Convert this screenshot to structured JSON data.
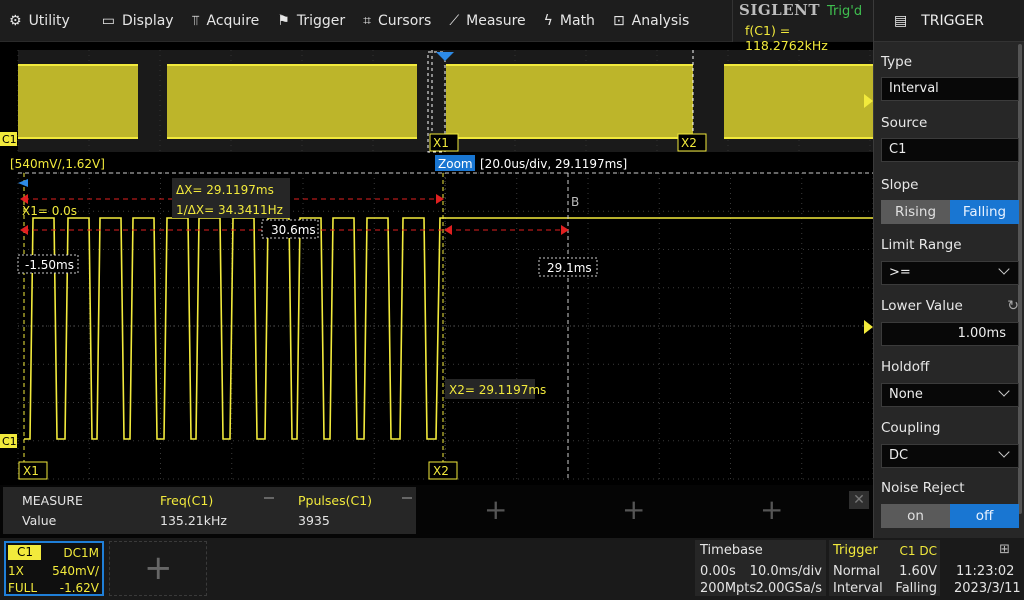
{
  "menu": [
    {
      "label": "Utility",
      "icon": "gear-icon",
      "glyph": "⚙"
    },
    {
      "label": "Display",
      "icon": "monitor-icon",
      "glyph": "▭"
    },
    {
      "label": "Acquire",
      "icon": "acquire-icon",
      "glyph": "⫪"
    },
    {
      "label": "Trigger",
      "icon": "flag-icon",
      "glyph": "⚑"
    },
    {
      "label": "Cursors",
      "icon": "crosshair-icon",
      "glyph": "⌗"
    },
    {
      "label": "Measure",
      "icon": "measure-icon",
      "glyph": "⟋"
    },
    {
      "label": "Math",
      "icon": "math-icon",
      "glyph": "ϟ"
    },
    {
      "label": "Analysis",
      "icon": "analysis-icon",
      "glyph": "⊡"
    }
  ],
  "brand": "SIGLENT",
  "trigger_status": "Trig'd",
  "freq_readout": "f(C1) = 118.2762kHz",
  "panel": {
    "title": "TRIGGER",
    "type_label": "Type",
    "type_value": "Interval",
    "source_label": "Source",
    "source_value": "C1",
    "slope_label": "Slope",
    "slope_options": [
      "Rising",
      "Falling"
    ],
    "slope_selected": "Falling",
    "limit_label": "Limit Range",
    "limit_value": ">=",
    "lower_label": "Lower Value",
    "lower_value": "1.00ms",
    "holdoff_label": "Holdoff",
    "holdoff_value": "None",
    "coupling_label": "Coupling",
    "coupling_value": "DC",
    "noise_label": "Noise Reject",
    "noise_options": [
      "on",
      "off"
    ],
    "noise_selected": "off"
  },
  "wave": {
    "overview_x1": "X1",
    "overview_x2": "X2",
    "ch_marker": "C1",
    "scale_readout": "[540mV/,1.62V]",
    "zoom_label": "Zoom",
    "zoom_readout": "[20.0us/div, 29.1197ms]",
    "delta_x": "ΔX= 29.1197ms",
    "inv_delta_x": "1/ΔX= 34.3411Hz",
    "x1_readout": "X1= 0.0s",
    "x2_readout": "X2= 29.1197ms",
    "meas_a": "30.6ms",
    "meas_b": "-1.50ms",
    "meas_c": "29.1ms",
    "b_marker": "B",
    "cursor_x1": "X1",
    "cursor_x2": "X2"
  },
  "measure": {
    "title": "MEASURE",
    "row_label": "Value",
    "items": [
      {
        "name": "Freq(C1)",
        "value": "135.21kHz"
      },
      {
        "name": "Ppulses(C1)",
        "value": "3935"
      }
    ]
  },
  "status": {
    "ch1": {
      "tag": "C1",
      "coupling": "DC1M",
      "probe": "1X",
      "scale": "540mV/",
      "bw": "FULL",
      "offset": "-1.62V"
    },
    "timebase": {
      "title": "Timebase",
      "delay": "0.00s",
      "scale": "10.0ms/div",
      "memory": "200Mpts",
      "rate": "2.00GSa/s"
    },
    "trigger": {
      "title": "Trigger",
      "source": "C1 DC",
      "mode": "Normal",
      "level": "1.60V",
      "type": "Interval",
      "slope": "Falling"
    },
    "time": "11:23:02",
    "date": "2023/3/11"
  },
  "colors": {
    "ch1": "#f2ea3c",
    "accent": "#1976d2",
    "cursor": "#e02020",
    "trig_ok": "#3fbf4f"
  }
}
